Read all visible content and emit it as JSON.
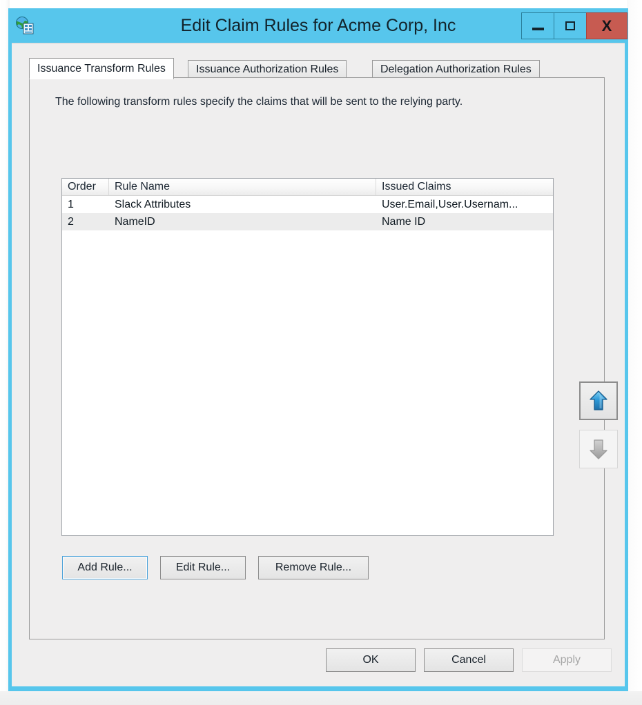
{
  "window": {
    "title": "Edit Claim Rules for Acme Corp, Inc",
    "icon": "adfs-globe-icon",
    "accent_color": "#57c6ec",
    "close_color": "#c75b51",
    "controls": {
      "minimize": "—",
      "maximize": "□",
      "close": "X"
    }
  },
  "tabs": [
    {
      "label": "Issuance Transform Rules",
      "active": true
    },
    {
      "label": "Issuance Authorization Rules",
      "active": false
    },
    {
      "label": "Delegation Authorization Rules",
      "active": false
    }
  ],
  "page": {
    "description": "The following transform rules specify the claims that will be sent to the relying party."
  },
  "rules_table": {
    "columns": [
      "Order",
      "Rule Name",
      "Issued Claims"
    ],
    "rows": [
      {
        "order": "1",
        "rule_name": "Slack Attributes",
        "issued_claims": "User.Email,User.Usernam...",
        "selected": false
      },
      {
        "order": "2",
        "rule_name": "NameID",
        "issued_claims": "Name ID",
        "selected": true
      }
    ]
  },
  "order_buttons": {
    "move_up": {
      "icon": "arrow-up-icon",
      "enabled": true
    },
    "move_down": {
      "icon": "arrow-down-icon",
      "enabled": false
    }
  },
  "rule_actions": [
    {
      "label": "Add Rule...",
      "focused": true
    },
    {
      "label": "Edit Rule...",
      "focused": false
    },
    {
      "label": "Remove Rule...",
      "focused": false
    }
  ],
  "footer": {
    "ok": "OK",
    "cancel": "Cancel",
    "apply": "Apply",
    "apply_enabled": false
  }
}
